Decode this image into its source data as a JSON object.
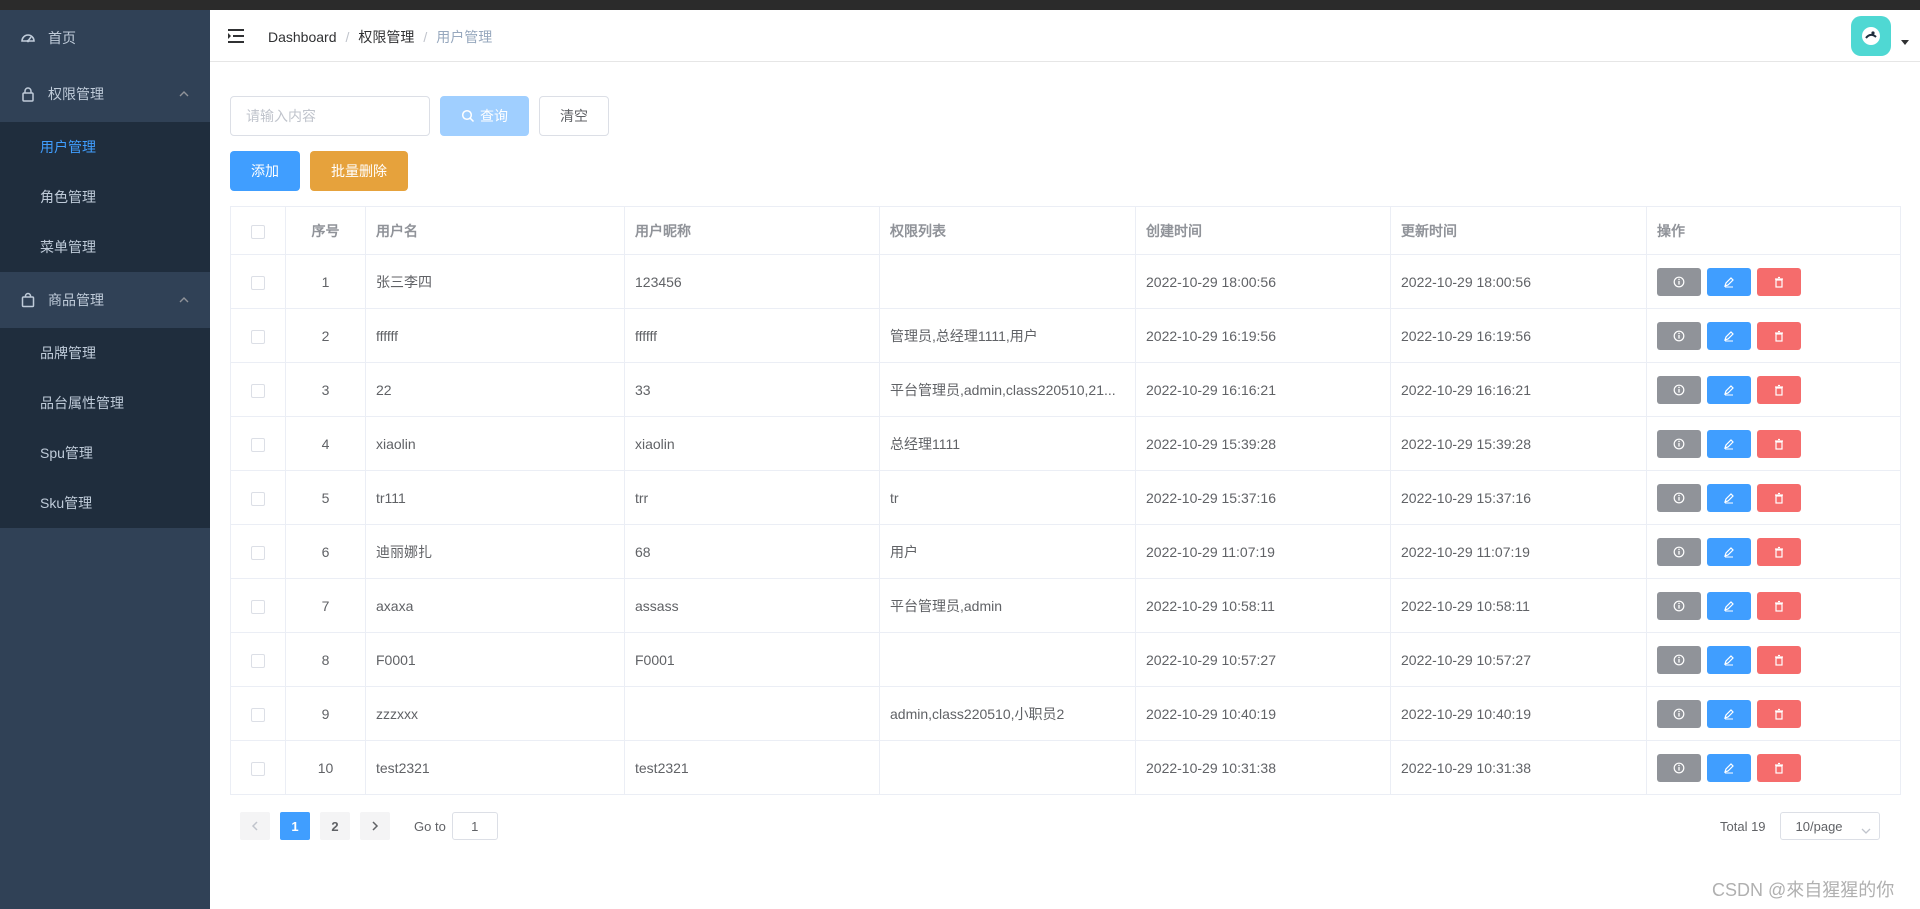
{
  "sidebar": {
    "home": "首页",
    "groups": [
      {
        "title": "权限管理",
        "items": [
          "用户管理",
          "角色管理",
          "菜单管理"
        ]
      },
      {
        "title": "商品管理",
        "items": [
          "品牌管理",
          "品台属性管理",
          "Spu管理",
          "Sku管理"
        ]
      }
    ]
  },
  "breadcrumb": [
    "Dashboard",
    "权限管理",
    "用户管理"
  ],
  "search": {
    "placeholder": "请输入内容",
    "query_label": "查询",
    "clear_label": "清空"
  },
  "actions": {
    "add_label": "添加",
    "batch_delete_label": "批量删除"
  },
  "table": {
    "headers": [
      "序号",
      "用户名",
      "用户昵称",
      "权限列表",
      "创建时间",
      "更新时间",
      "操作"
    ],
    "rows": [
      {
        "idx": "1",
        "username": "张三李四",
        "nickname": "123456",
        "roles": "",
        "created": "2022-10-29 18:00:56",
        "updated": "2022-10-29 18:00:56"
      },
      {
        "idx": "2",
        "username": "ffffff",
        "nickname": "ffffff",
        "roles": "管理员,总经理1111,用户",
        "created": "2022-10-29 16:19:56",
        "updated": "2022-10-29 16:19:56"
      },
      {
        "idx": "3",
        "username": "22",
        "nickname": "33",
        "roles": "平台管理员,admin,class220510,21...",
        "created": "2022-10-29 16:16:21",
        "updated": "2022-10-29 16:16:21"
      },
      {
        "idx": "4",
        "username": "xiaolin",
        "nickname": "xiaolin",
        "roles": "总经理1111",
        "created": "2022-10-29 15:39:28",
        "updated": "2022-10-29 15:39:28"
      },
      {
        "idx": "5",
        "username": "tr111",
        "nickname": "trr",
        "roles": "tr",
        "created": "2022-10-29 15:37:16",
        "updated": "2022-10-29 15:37:16"
      },
      {
        "idx": "6",
        "username": "迪丽娜扎",
        "nickname": "68",
        "roles": "用户",
        "created": "2022-10-29 11:07:19",
        "updated": "2022-10-29 11:07:19"
      },
      {
        "idx": "7",
        "username": "axaxa",
        "nickname": "assass",
        "roles": "平台管理员,admin",
        "created": "2022-10-29 10:58:11",
        "updated": "2022-10-29 10:58:11"
      },
      {
        "idx": "8",
        "username": "F0001",
        "nickname": "F0001",
        "roles": "",
        "created": "2022-10-29 10:57:27",
        "updated": "2022-10-29 10:57:27"
      },
      {
        "idx": "9",
        "username": "zzzxxx",
        "nickname": "",
        "roles": "admin,class220510,小职员2",
        "created": "2022-10-29 10:40:19",
        "updated": "2022-10-29 10:40:19"
      },
      {
        "idx": "10",
        "username": "test2321",
        "nickname": "test2321",
        "roles": "",
        "created": "2022-10-29 10:31:38",
        "updated": "2022-10-29 10:31:38"
      }
    ]
  },
  "pagination": {
    "pages": [
      "1",
      "2"
    ],
    "current": "1",
    "goto_label": "Go to",
    "goto_value": "1",
    "total": "Total 19",
    "page_size": "10/page"
  },
  "watermark": "CSDN @來自猩猩的你",
  "colors": {
    "sidebar_bg": "#304156",
    "submenu_bg": "#1f2d3d",
    "primary": "#409eff",
    "warning": "#e6a23c",
    "danger": "#f56c6c",
    "info": "#909399",
    "avatar_bg": "#4fd8d3"
  },
  "icons": {
    "home": "dashboard-icon",
    "permission": "lock-icon",
    "goods": "shopping-bag-icon",
    "row_info": "info-icon",
    "row_edit": "edit-icon",
    "row_delete": "delete-icon"
  }
}
